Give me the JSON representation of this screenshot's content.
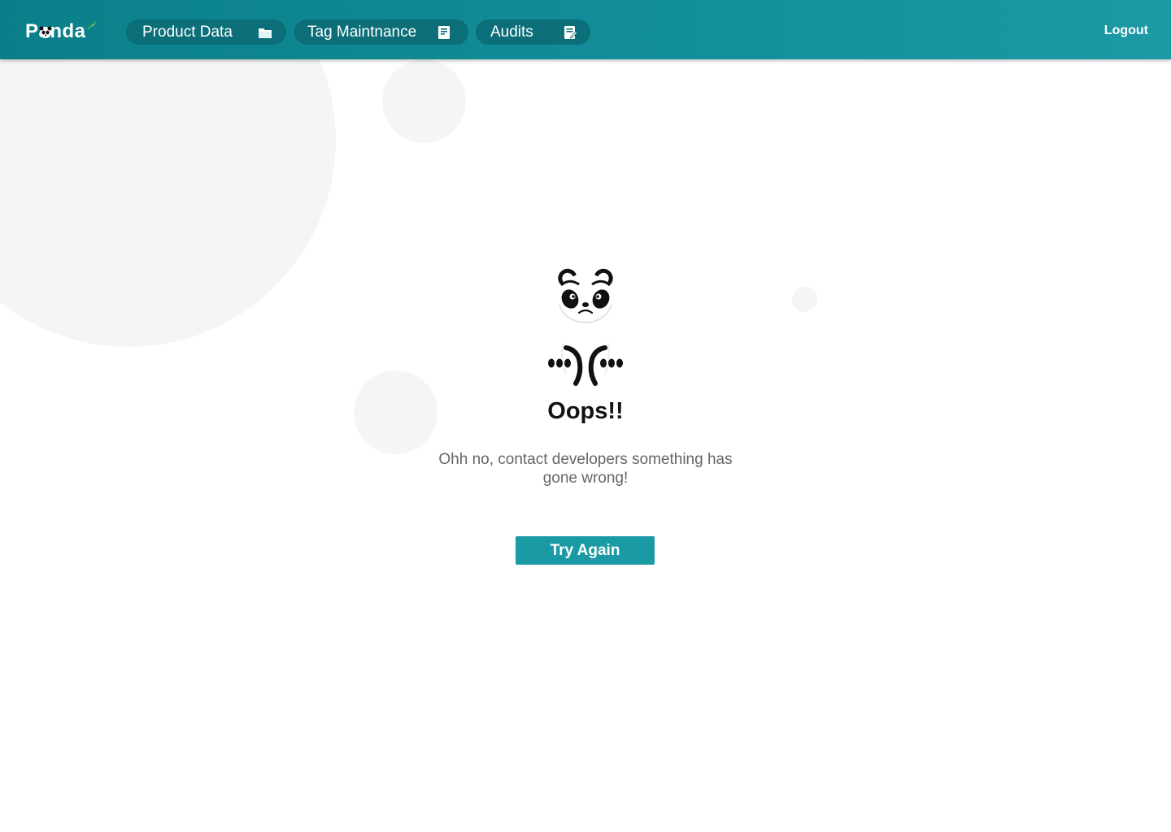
{
  "header": {
    "brand": "Panda",
    "nav": [
      {
        "label": "Product Data",
        "icon": "folder-icon"
      },
      {
        "label": "Tag Maintnance",
        "icon": "document-icon"
      },
      {
        "label": "Audits",
        "icon": "audit-icon"
      }
    ],
    "logout_label": "Logout"
  },
  "error": {
    "title": "Oops!!",
    "message": "Ohh no, contact developers something has gone wrong!",
    "button_label": "Try Again",
    "illustration": "sad-panda-icon"
  },
  "colors": {
    "header_start": "#0a7f89",
    "header_end": "#1a9aa4",
    "pill": "#0b6e78",
    "accent": "#1a9aa4",
    "bubble": "#f5f5f5"
  }
}
